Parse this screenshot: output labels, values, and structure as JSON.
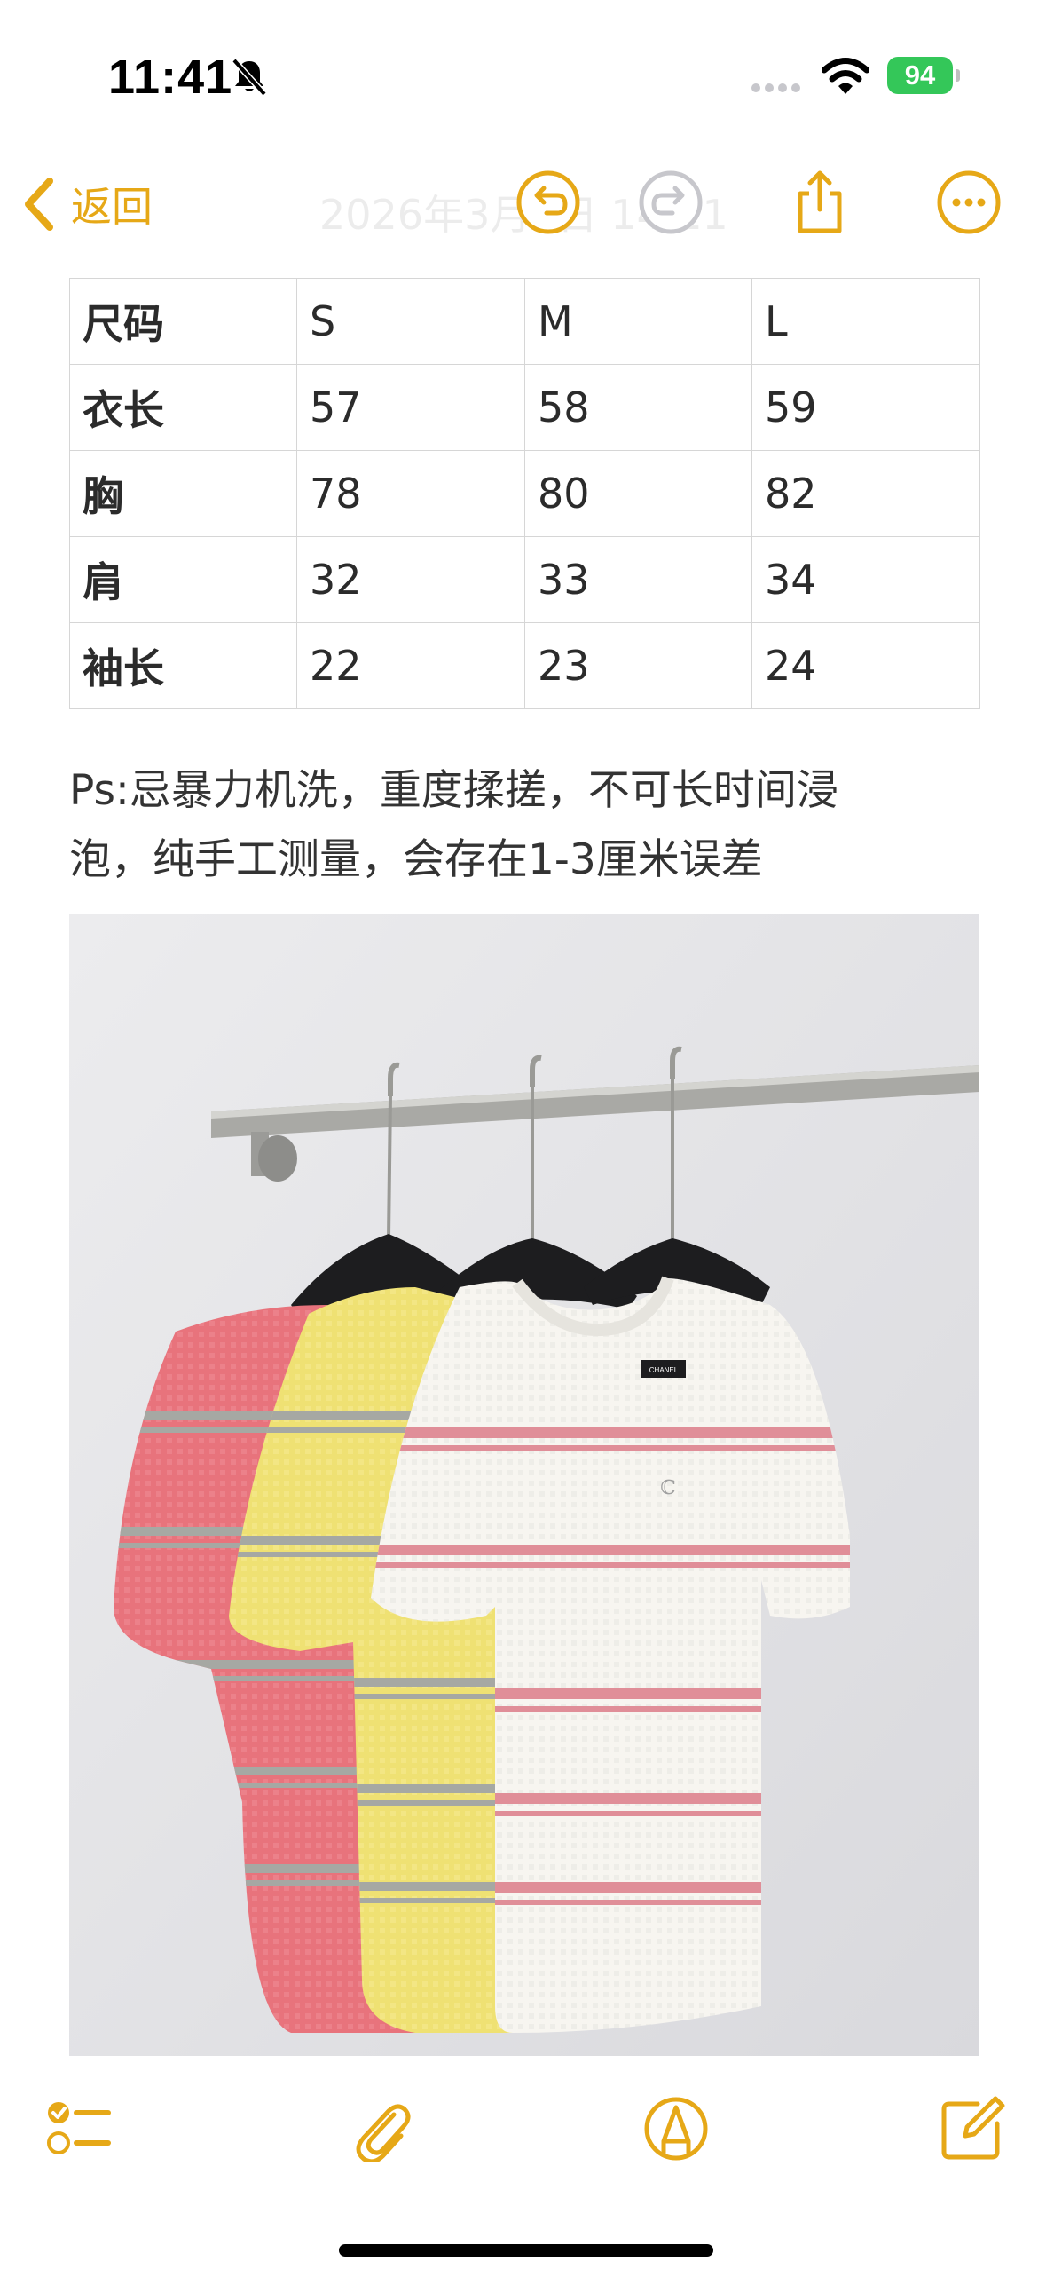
{
  "status_bar": {
    "time": "11:41",
    "battery": "94"
  },
  "nav": {
    "back_label": "返回",
    "title": "2026年3月1日 14:11"
  },
  "size_table": {
    "rows": [
      [
        "尺码",
        "S",
        "M",
        "L"
      ],
      [
        "衣长",
        "57",
        "58",
        "59"
      ],
      [
        "胸",
        "78",
        "80",
        "82"
      ],
      [
        "肩",
        "32",
        "33",
        "34"
      ],
      [
        "袖长",
        "22",
        "23",
        "24"
      ]
    ]
  },
  "note": {
    "line1": "Ps:忌暴力机洗，重度揉搓，不可长时间浸",
    "line2": "泡，纯手工测量，会存在1-3厘米误差"
  },
  "photo": {
    "label_text": "CHANEL"
  },
  "colors": {
    "accent": "#E6A817",
    "battery": "#34C759",
    "shirt_pink": "#E8737C",
    "shirt_yellow": "#EFE173",
    "shirt_white": "#F7F5F0",
    "stripe_grey": "#A6A8A3",
    "stripe_pink": "#E08E98"
  },
  "icons": [
    "bell-slash-icon",
    "signal-icon",
    "wifi-icon",
    "chevron-left-icon",
    "undo-icon",
    "redo-icon",
    "share-icon",
    "more-icon",
    "checklist-icon",
    "paperclip-icon",
    "markup-icon",
    "compose-icon"
  ]
}
